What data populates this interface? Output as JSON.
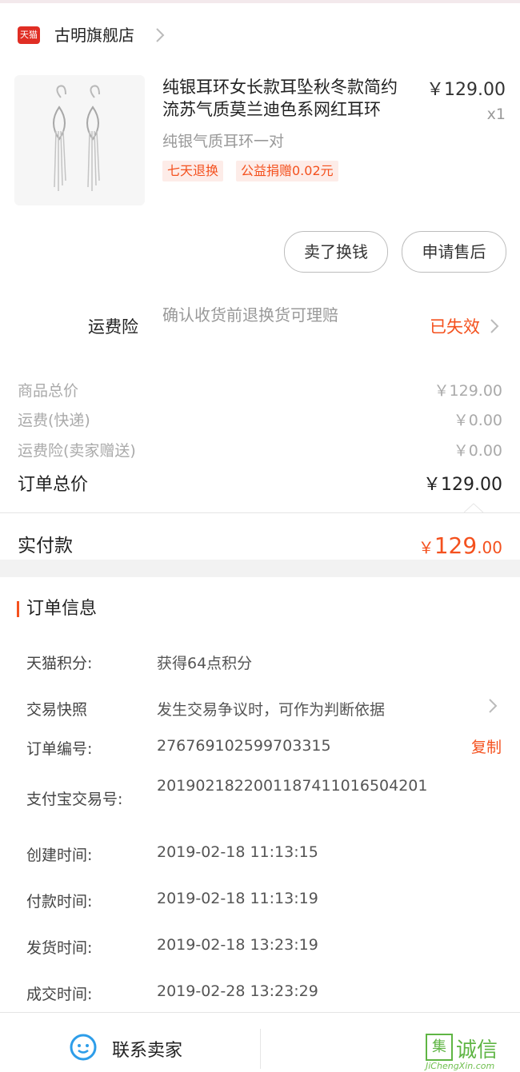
{
  "store": {
    "badge": "天猫",
    "name": "古明旗舰店"
  },
  "product": {
    "title": "纯银耳环女长款耳坠秋冬款简约流苏气质莫兰迪色系网红耳环",
    "price": "￥129.00",
    "quantity": "x1",
    "spec": "纯银气质耳环一对",
    "tags": [
      "七天退换",
      "公益捐赠0.02元"
    ]
  },
  "actions": {
    "sell_label": "卖了换钱",
    "after_sale_label": "申请售后"
  },
  "insurance": {
    "label": "运费险",
    "description": "确认收货前退换货可理赔",
    "status": "已失效"
  },
  "fees": [
    {
      "label": "商品总价",
      "value": "￥129.00"
    },
    {
      "label": "运费(快递)",
      "value": "￥0.00"
    },
    {
      "label": "运费险(卖家赠送)",
      "value": "￥0.00"
    }
  ],
  "order_total": {
    "label": "订单总价",
    "value": "￥129.00"
  },
  "paid": {
    "label": "实付款",
    "currency": "￥",
    "integer": "129",
    "decimal": ".00"
  },
  "order_info": {
    "title": "订单信息",
    "points": {
      "label": "天猫积分:",
      "value": "获得64点积分"
    },
    "snapshot": {
      "label": "交易快照",
      "value": "发生交易争议时，可作为判断依据"
    },
    "order_no": {
      "label": "订单编号:",
      "value": "276769102599703315",
      "copy_label": "复制"
    },
    "alipay_no": {
      "label": "支付宝交易号:",
      "value": "2019021822001187411016504201"
    },
    "created": {
      "label": "创建时间:",
      "value": "2019-02-18 11:13:15"
    },
    "paid_at": {
      "label": "付款时间:",
      "value": "2019-02-18 11:13:19"
    },
    "shipped": {
      "label": "发货时间:",
      "value": "2019-02-18 13:23:19"
    },
    "completed": {
      "label": "成交时间:",
      "value": "2019-02-28 13:23:29"
    }
  },
  "bottom_bar": {
    "contact_label": "联系卖家"
  },
  "watermark": {
    "box_char": "集",
    "text": "诚信",
    "url": "JiChengXin.com"
  }
}
